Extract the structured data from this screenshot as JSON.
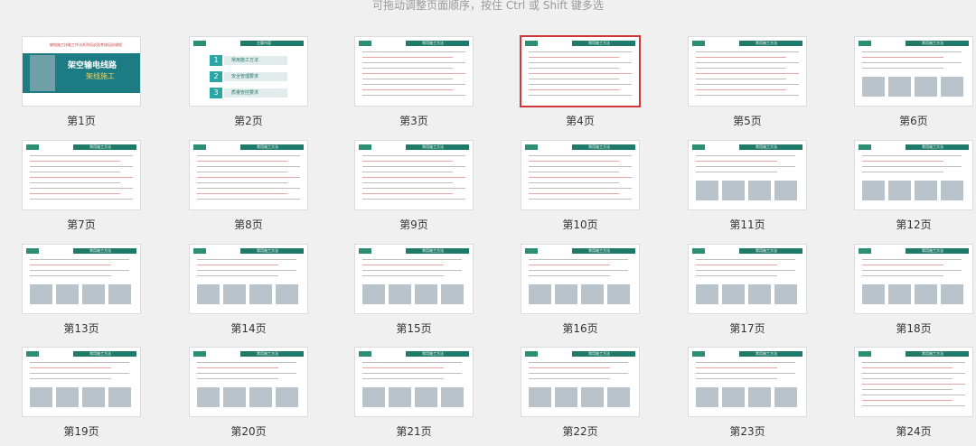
{
  "hint": "可拖动调整页面顺序，按住 Ctrl 或 Shift 键多选",
  "slides": [
    {
      "label": "第1页",
      "kind": "cover",
      "title": "架空输电线路",
      "subtitle": "架线施工",
      "top": "输电施工技能工作法系列培训及考核培训课程"
    },
    {
      "label": "第2页",
      "kind": "toc",
      "header": "主要内容",
      "items": [
        "常用施工方法",
        "安全管理要求",
        "质量管控要求"
      ]
    },
    {
      "label": "第3页",
      "kind": "text",
      "header": "常用施工方法"
    },
    {
      "label": "第4页",
      "kind": "text",
      "header": "常用施工方法",
      "selected": true
    },
    {
      "label": "第5页",
      "kind": "text",
      "header": "常用施工方法"
    },
    {
      "label": "第6页",
      "kind": "img",
      "header": "常用施工方法"
    },
    {
      "label": "第7页",
      "kind": "text",
      "header": "常用施工方法"
    },
    {
      "label": "第8页",
      "kind": "text",
      "header": "常用施工方法"
    },
    {
      "label": "第9页",
      "kind": "text",
      "header": "常用施工方法"
    },
    {
      "label": "第10页",
      "kind": "text",
      "header": "常用施工方法"
    },
    {
      "label": "第11页",
      "kind": "img",
      "header": "常用施工方法"
    },
    {
      "label": "第12页",
      "kind": "img",
      "header": "常用施工方法"
    },
    {
      "label": "第13页",
      "kind": "img",
      "header": "常用施工方法"
    },
    {
      "label": "第14页",
      "kind": "img",
      "header": "常用施工方法"
    },
    {
      "label": "第15页",
      "kind": "img",
      "header": "常用施工方法"
    },
    {
      "label": "第16页",
      "kind": "img",
      "header": "常用施工方法"
    },
    {
      "label": "第17页",
      "kind": "img",
      "header": "常用施工方法"
    },
    {
      "label": "第18页",
      "kind": "img",
      "header": "常用施工方法"
    },
    {
      "label": "第19页",
      "kind": "img",
      "header": "常用施工方法"
    },
    {
      "label": "第20页",
      "kind": "img",
      "header": "常用施工方法"
    },
    {
      "label": "第21页",
      "kind": "img",
      "header": "常用施工方法"
    },
    {
      "label": "第22页",
      "kind": "img",
      "header": "常用施工方法"
    },
    {
      "label": "第23页",
      "kind": "img",
      "header": "常用施工方法"
    },
    {
      "label": "第24页",
      "kind": "text",
      "header": "常用施工方法"
    }
  ]
}
